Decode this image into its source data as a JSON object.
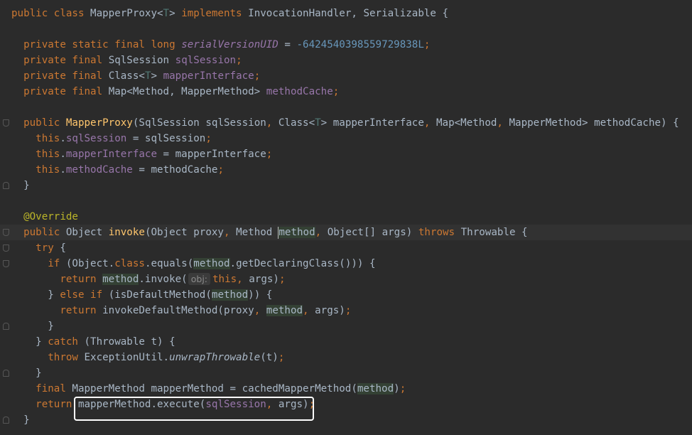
{
  "editor": {
    "lines": [
      {
        "fold": "",
        "segs": [
          [
            "kw",
            "public class "
          ],
          [
            "",
            "MapperProxy<"
          ],
          [
            "tp",
            "T"
          ],
          [
            "",
            "> "
          ],
          [
            "kw",
            "implements "
          ],
          [
            "",
            "InvocationHandler, Serializable {"
          ]
        ]
      },
      {
        "fold": "",
        "segs": []
      },
      {
        "fold": "",
        "segs": [
          [
            "",
            "  "
          ],
          [
            "kw",
            "private static final long "
          ],
          [
            "fld ital",
            "serialVersionUID"
          ],
          [
            "",
            " = "
          ],
          [
            "num",
            "-6424540398559729838L"
          ],
          [
            "kw",
            ";"
          ]
        ]
      },
      {
        "fold": "",
        "segs": [
          [
            "",
            "  "
          ],
          [
            "kw",
            "private final "
          ],
          [
            "",
            "SqlSession "
          ],
          [
            "fld",
            "sqlSession"
          ],
          [
            "kw",
            ";"
          ]
        ]
      },
      {
        "fold": "",
        "segs": [
          [
            "",
            "  "
          ],
          [
            "kw",
            "private final "
          ],
          [
            "",
            "Class<"
          ],
          [
            "tp",
            "T"
          ],
          [
            "",
            "> "
          ],
          [
            "fld",
            "mapperInterface"
          ],
          [
            "kw",
            ";"
          ]
        ]
      },
      {
        "fold": "",
        "segs": [
          [
            "",
            "  "
          ],
          [
            "kw",
            "private final "
          ],
          [
            "",
            "Map<Method, MapperMethod> "
          ],
          [
            "fld",
            "methodCache"
          ],
          [
            "kw",
            ";"
          ]
        ]
      },
      {
        "fold": "",
        "segs": []
      },
      {
        "fold": "start",
        "segs": [
          [
            "",
            "  "
          ],
          [
            "kw",
            "public "
          ],
          [
            "fn",
            "MapperProxy"
          ],
          [
            "",
            "(SqlSession sqlSession"
          ],
          [
            "kw",
            ", "
          ],
          [
            "",
            "Class<"
          ],
          [
            "tp",
            "T"
          ],
          [
            "",
            "> mapperInterface"
          ],
          [
            "kw",
            ", "
          ],
          [
            "",
            "Map<Method"
          ],
          [
            "kw",
            ", "
          ],
          [
            "",
            "MapperMethod> methodCache) {"
          ]
        ]
      },
      {
        "fold": "",
        "segs": [
          [
            "",
            "    "
          ],
          [
            "kw",
            "this"
          ],
          [
            "",
            "."
          ],
          [
            "fld",
            "sqlSession"
          ],
          [
            "",
            " = sqlSession"
          ],
          [
            "kw",
            ";"
          ]
        ]
      },
      {
        "fold": "",
        "segs": [
          [
            "",
            "    "
          ],
          [
            "kw",
            "this"
          ],
          [
            "",
            "."
          ],
          [
            "fld",
            "mapperInterface"
          ],
          [
            "",
            " = mapperInterface"
          ],
          [
            "kw",
            ";"
          ]
        ]
      },
      {
        "fold": "",
        "segs": [
          [
            "",
            "    "
          ],
          [
            "kw",
            "this"
          ],
          [
            "",
            "."
          ],
          [
            "fld",
            "methodCache"
          ],
          [
            "",
            " = methodCache"
          ],
          [
            "kw",
            ";"
          ]
        ]
      },
      {
        "fold": "end",
        "segs": [
          [
            "",
            "  }"
          ]
        ]
      },
      {
        "fold": "",
        "segs": []
      },
      {
        "fold": "",
        "segs": [
          [
            "",
            "  "
          ],
          [
            "ann",
            "@Override"
          ]
        ]
      },
      {
        "fold": "start",
        "current": true,
        "segs": [
          [
            "",
            "  "
          ],
          [
            "kw",
            "public "
          ],
          [
            "",
            "Object "
          ],
          [
            "fn",
            "invoke"
          ],
          [
            "",
            "(Object proxy"
          ],
          [
            "kw",
            ", "
          ],
          [
            "",
            "Method "
          ],
          [
            "caret",
            ""
          ],
          [
            "hl",
            "method"
          ],
          [
            "kw",
            ", "
          ],
          [
            "",
            "Object[] args) "
          ],
          [
            "kw",
            "throws "
          ],
          [
            "",
            "Throwable {"
          ]
        ]
      },
      {
        "fold": "start",
        "segs": [
          [
            "",
            "    "
          ],
          [
            "kw",
            "try "
          ],
          [
            "",
            "{"
          ]
        ]
      },
      {
        "fold": "start",
        "segs": [
          [
            "",
            "      "
          ],
          [
            "kw",
            "if "
          ],
          [
            "",
            "(Object."
          ],
          [
            "kw",
            "class"
          ],
          [
            "",
            ".equals("
          ],
          [
            "hl",
            "method"
          ],
          [
            "",
            ".getDeclaringClass())) {"
          ]
        ]
      },
      {
        "fold": "",
        "segs": [
          [
            "",
            "        "
          ],
          [
            "kw",
            "return "
          ],
          [
            "hl",
            "method"
          ],
          [
            "",
            ".invoke("
          ],
          [
            "hint",
            "obj:"
          ],
          [
            "kw",
            "this, "
          ],
          [
            "",
            "args)"
          ],
          [
            "kw",
            ";"
          ]
        ]
      },
      {
        "fold": "",
        "segs": [
          [
            "",
            "      } "
          ],
          [
            "kw",
            "else if "
          ],
          [
            "",
            "(isDefaultMethod("
          ],
          [
            "hl",
            "method"
          ],
          [
            "",
            ")) {"
          ]
        ]
      },
      {
        "fold": "",
        "segs": [
          [
            "",
            "        "
          ],
          [
            "kw",
            "return "
          ],
          [
            "",
            "invokeDefaultMethod(proxy"
          ],
          [
            "kw",
            ", "
          ],
          [
            "hl",
            "method"
          ],
          [
            "kw",
            ", "
          ],
          [
            "",
            "args)"
          ],
          [
            "kw",
            ";"
          ]
        ]
      },
      {
        "fold": "end",
        "segs": [
          [
            "",
            "      }"
          ]
        ]
      },
      {
        "fold": "",
        "segs": [
          [
            "",
            "    } "
          ],
          [
            "kw",
            "catch "
          ],
          [
            "",
            "(Throwable t) {"
          ]
        ]
      },
      {
        "fold": "",
        "segs": [
          [
            "",
            "      "
          ],
          [
            "kw",
            "throw "
          ],
          [
            "",
            "ExceptionUtil."
          ],
          [
            "ital",
            "unwrapThrowable"
          ],
          [
            "",
            "(t)"
          ],
          [
            "kw",
            ";"
          ]
        ]
      },
      {
        "fold": "end",
        "segs": [
          [
            "",
            "    }"
          ]
        ]
      },
      {
        "fold": "",
        "segs": [
          [
            "",
            "    "
          ],
          [
            "kw",
            "final "
          ],
          [
            "",
            "MapperMethod mapperMethod = cachedMapperMethod("
          ],
          [
            "hl",
            "method"
          ],
          [
            "",
            ")"
          ],
          [
            "kw",
            ";"
          ]
        ]
      },
      {
        "fold": "",
        "segs": [
          [
            "",
            "    "
          ],
          [
            "kw",
            "return "
          ],
          [
            "",
            "mapperMethod.execute("
          ],
          [
            "fld",
            "sqlSession"
          ],
          [
            "kw",
            ", "
          ],
          [
            "",
            "args)"
          ],
          [
            "kw",
            ";"
          ]
        ]
      },
      {
        "fold": "end",
        "segs": [
          [
            "",
            "  }"
          ]
        ]
      }
    ]
  }
}
